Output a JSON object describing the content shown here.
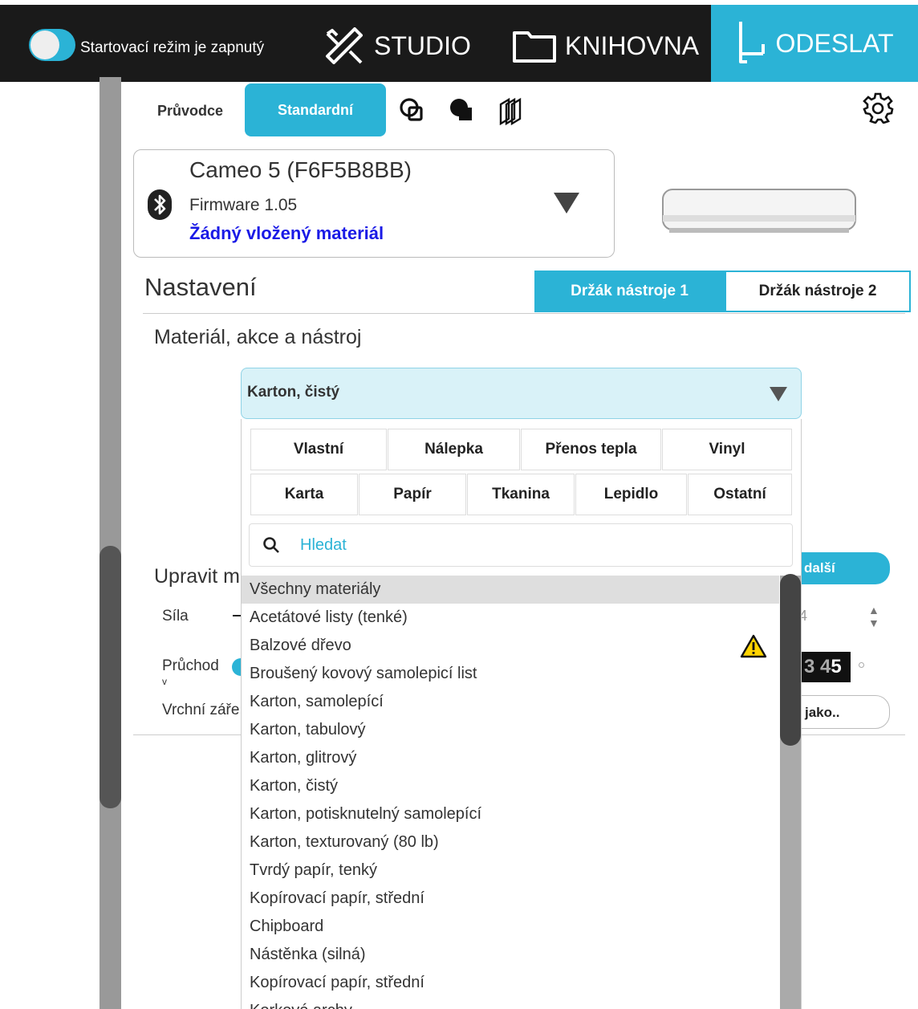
{
  "topbar": {
    "startup_label": "Startovací režim je zapnutý",
    "studio": "STUDIO",
    "library": "KNIHOVNA",
    "send": "ODESLAT",
    "accent": "#2bb3d6"
  },
  "modes": {
    "guide": "Průvodce",
    "standard": "Standardní",
    "icons": [
      "weld-icon",
      "fill-icon",
      "layers-icon"
    ],
    "settings_icon": "gear-icon"
  },
  "device": {
    "name": "Cameo 5 (F6F5B8BB)",
    "firmware": "Firmware 1.05",
    "material_status": "Žádný vložený materiál"
  },
  "settings": {
    "title": "Nastavení",
    "holder1": "Držák nástroje 1",
    "holder2": "Držák nástroje 2",
    "section": "Materiál, akce a nástroj"
  },
  "material_select": {
    "value": "Karton, čistý"
  },
  "behind": {
    "edit_label": "Upravit m",
    "force_label": "Síla",
    "pass_label": "Průchod",
    "pass_sub": "v",
    "top_label": "Vrchní záře",
    "more_button": "další",
    "save_as_button": "jako..",
    "force_digit": "4",
    "num_strip_a": "3 4",
    "num_strip_b": "5"
  },
  "categories": {
    "row1": [
      "Vlastní",
      "Nálepka",
      "Přenos tepla",
      "Vinyl"
    ],
    "row2": [
      "Karta",
      "Papír",
      "Tkanina",
      "Lepidlo",
      "Ostatní"
    ]
  },
  "search": {
    "placeholder": "Hledat"
  },
  "materials": [
    "Všechny materiály",
    "Acetátové listy (tenké)",
    "Balzové dřevo",
    "Broušený kovový samolepicí list",
    "Karton, samolepící",
    "Karton, tabulový",
    "Karton, glitrový",
    "Karton, čistý",
    "Karton, potisknutelný samolepící",
    "Karton, texturovaný (80 lb)",
    "Tvrdý papír, tenký",
    "Kopírovací papír, střední",
    "Chipboard",
    "Nástěnka (silná)",
    "Kopírovací papír, střední",
    "Korkové archy"
  ]
}
